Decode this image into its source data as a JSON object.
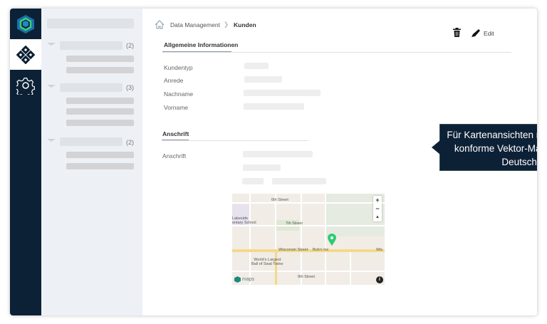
{
  "sidebar": {
    "groups": [
      {
        "count": "(2)"
      },
      {
        "count": "(3)"
      },
      {
        "count": "(2)"
      }
    ]
  },
  "breadcrumb": {
    "parent": "Data Management",
    "current": "Kunden"
  },
  "toolbar": {
    "edit_label": "Edit"
  },
  "sections": {
    "general": "Allgemeine Informationen",
    "address": "Anschrift"
  },
  "fields": {
    "kundentyp": "Kundentyp",
    "anrede": "Anrede",
    "nachname": "Nachname",
    "vorname": "Vorname",
    "anschrift": "Anschrift"
  },
  "tooltip": "Für Kartenansichten nutzen wir eigene DSGVO-konforme Vektor-Maps. Alle Daten werden in Deutschland gehostet.",
  "map": {
    "streets": {
      "s6": "6th Street",
      "s7": "7th Street",
      "s9": "9th Street",
      "wisconsin": "Wisconsin Street",
      "wis": "Wis"
    },
    "poi": {
      "school": "Lakeside\nentary School",
      "bobs": "Bob's Inc",
      "twine": "World's Largest\nBall of Sisal Twine"
    },
    "brand": "maps",
    "zoom_in": "+",
    "zoom_out": "−",
    "compass": "▲",
    "info": "i"
  },
  "colors": {
    "nav": "#0d2136",
    "accent": "#2ecc71"
  }
}
